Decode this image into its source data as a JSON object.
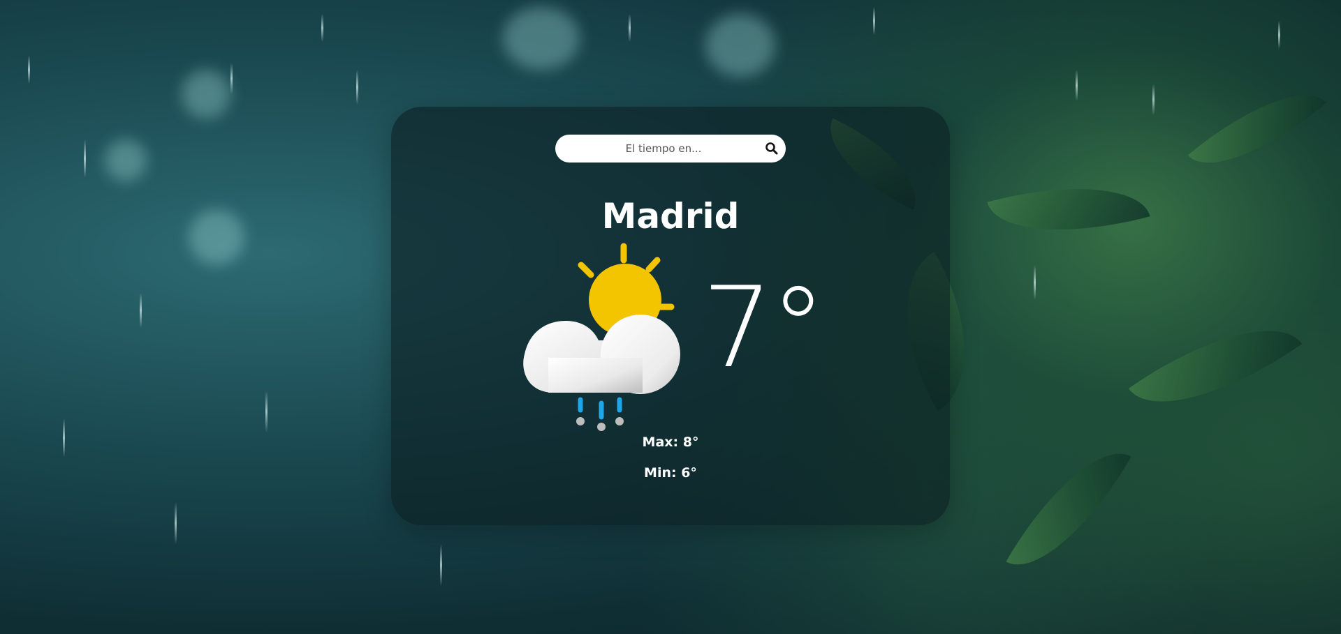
{
  "search": {
    "placeholder": "El tiempo en...",
    "value": "",
    "icon": "search-icon"
  },
  "weather": {
    "city": "Madrid",
    "temperature": "7°",
    "max": "Max: 8°",
    "min": "Min: 6°",
    "icon": "partly-cloudy-rain-icon"
  },
  "colors": {
    "sun": "#F2C500",
    "rain": "#1EA7E8",
    "card": "#0C1E22"
  }
}
